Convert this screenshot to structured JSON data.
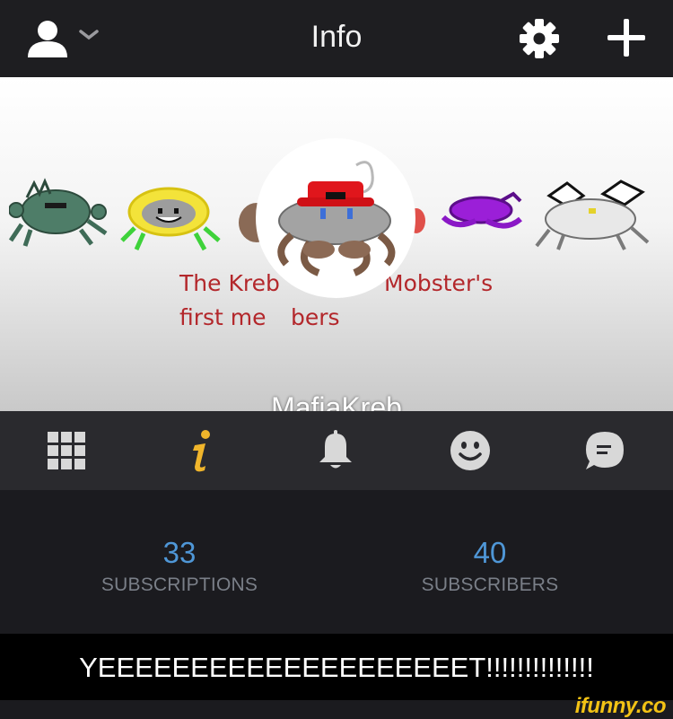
{
  "header": {
    "title": "Info",
    "user_menu_icon": "user-icon",
    "dropdown_icon": "chevron-down-icon",
    "settings_icon": "gear-icon",
    "add_icon": "plus-icon"
  },
  "banner": {
    "caption_line1_left": "The Kreb",
    "caption_line1_right": "Mobster's",
    "caption_line2": "first me",
    "caption_line2_tail": "bers"
  },
  "profile": {
    "name": "MafiaKreb"
  },
  "tabs": [
    {
      "icon": "grid-icon",
      "active": false
    },
    {
      "icon": "info-icon",
      "active": true
    },
    {
      "icon": "bell-icon",
      "active": false
    },
    {
      "icon": "smiley-icon",
      "active": false
    },
    {
      "icon": "chat-icon",
      "active": false
    }
  ],
  "stats": {
    "subscriptions_count": "33",
    "subscriptions_label": "SUBSCRIPTIONS",
    "subscribers_count": "40",
    "subscribers_label": "SUBSCRIBERS"
  },
  "bio": {
    "text": "YEEEEEEEEEEEEEEEEEEEET!!!!!!!!!!!!!!"
  },
  "watermark": {
    "text": "ifunny.co"
  },
  "colors": {
    "accent_blue": "#4f97d7",
    "active_tab": "#f0b52b",
    "caption_red": "#b3272b",
    "watermark_yellow": "#f3c315"
  }
}
